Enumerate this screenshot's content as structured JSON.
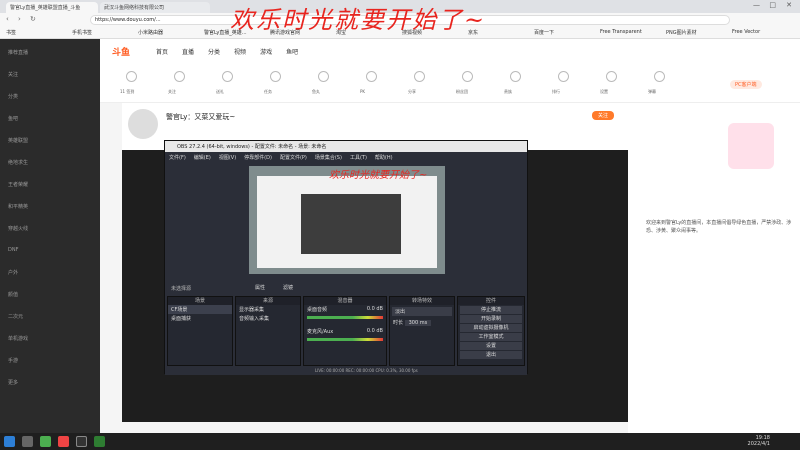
{
  "browser": {
    "tabs": [
      "警官Ly直播_英雄联盟直播_斗鱼",
      "武汉斗鱼网络科技有限公司"
    ],
    "url": "https://www.douyu.com/...",
    "bookmarks": [
      "书签",
      "手机书签",
      "小米路由器",
      "警官Ly直播_英雄...",
      "腾讯游戏官网",
      "淘宝",
      "搜狐视频",
      "京东",
      "百度一下",
      "Free Transparent",
      "PNG图片素材",
      "Free Vector"
    ]
  },
  "site": {
    "logo": "斗鱼",
    "nav": [
      "首页",
      "直播",
      "分类",
      "视频",
      "游戏",
      "鱼吧"
    ],
    "categories": [
      "11 签到",
      "关注",
      "送礼",
      "任务",
      "鱼丸",
      "PK",
      "分享",
      "粉丝团",
      "贵族",
      "排行",
      "设置",
      "弹幕"
    ],
    "streamer_name": "警官Ly：又菜又爱玩~",
    "follow_label": "关注",
    "pc_badge": "PC客户端"
  },
  "sidebar": {
    "items": [
      "推荐直播",
      "关注",
      "分类",
      "鱼吧",
      "英雄联盟",
      "绝地求生",
      "王者荣耀",
      "和平精英",
      "穿越火线",
      "DNF",
      "户外",
      "颜值",
      "二次元",
      "单机游戏",
      "手游",
      "更多"
    ]
  },
  "obs": {
    "title": "OBS 27.2.4 (64-bit, windows) - 配置文件: 未命名 - 场景: 未命名",
    "menu": [
      "文件(F)",
      "编辑(E)",
      "视图(V)",
      "停靠部件(D)",
      "配置文件(P)",
      "场景集合(S)",
      "工具(T)",
      "帮助(H)"
    ],
    "preview_overlay": "欢乐时光就要开始了~",
    "no_source": "未选择源",
    "props": "属性",
    "filters": "滤镜",
    "docks": {
      "scenes": {
        "title": "场景",
        "items": [
          "CF场景",
          "桌面捕获"
        ]
      },
      "sources": {
        "title": "来源",
        "items": [
          "显示器采集",
          "音频输入采集"
        ]
      },
      "mixer": {
        "title": "混音器",
        "items": [
          "桌面音频",
          "麦克风/Aux"
        ],
        "db": [
          "0.0 dB",
          "0.0 dB"
        ]
      },
      "transitions": {
        "title": "转场特效",
        "type": "淡出",
        "duration_label": "时长",
        "duration": "300 ms"
      },
      "controls": {
        "title": "控件",
        "buttons": [
          "停止推流",
          "开始录制",
          "启动虚拟摄像机",
          "工作室模式",
          "设置",
          "退出"
        ]
      }
    },
    "status": "LIVE: 00:00:00   REC: 00:00:00   CPU: 0.3%, 30.00 fps"
  },
  "banner": "欢乐时光就要开始了~",
  "chat": [
    "欢迎来到警官Ly的直播间，本直播间倡导绿色直播，严禁涉政、涉恐、涉黄、聚众闹事等。"
  ],
  "taskbar": {
    "time": "19:18",
    "date": "2022/4/1"
  }
}
